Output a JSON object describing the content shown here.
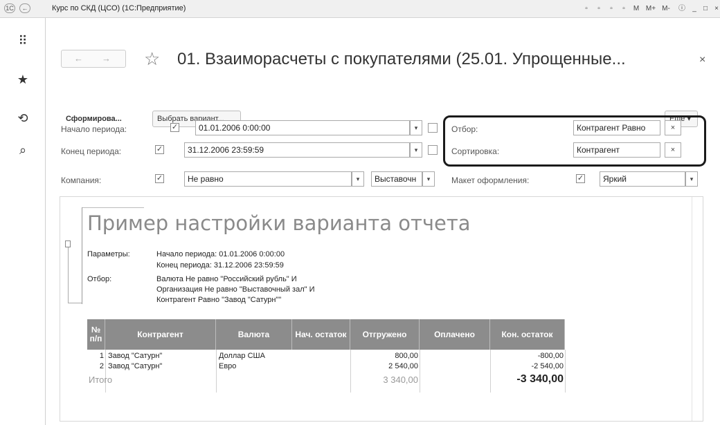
{
  "window": {
    "title": "Курс по СКД (ЦСО) (1С:Предприятие)",
    "toolbar_m_labels": [
      "M",
      "M+",
      "M-"
    ]
  },
  "header": {
    "title": "01. Взаиморасчеты с покупателями (25.01. Упрощенные...",
    "back_arrow": "←",
    "forward_arrow": "→",
    "close": "×"
  },
  "toolbar": {
    "generate_label": "Сформирова...",
    "variant_label": "Выбрать вариант...",
    "more_label": "Еще ▾"
  },
  "form": {
    "period_start_label": "Начало периода:",
    "period_start_value": "01.01.2006 0:00:00",
    "period_end_label": "Конец периода:",
    "period_end_value": "31.12.2006 23:59:59",
    "company_label": "Компания:",
    "company_condition": "Не равно",
    "company_value": "Выставочн",
    "filter_label": "Отбор:",
    "filter_value": "Контрагент Равно",
    "sort_label": "Сортировка:",
    "sort_value": "Контрагент",
    "layout_label": "Макет оформления:",
    "layout_value": "Яркий"
  },
  "report": {
    "title": "Пример настройки варианта отчета",
    "params_label": "Параметры:",
    "param_start": "Начало периода: 01.01.2006 0:00:00",
    "param_end": "Конец периода: 31.12.2006 23:59:59",
    "filter_label": "Отбор:",
    "filter_line1": "Валюта Не равно \"Российский рубль\" И",
    "filter_line2": "Организация Не равно \"Выставочный зал\" И",
    "filter_line3": "Контрагент Равно \"Завод \"Сатурн\"\"",
    "columns": [
      "№ п/п",
      "Контрагент",
      "Валюта",
      "Нач. остаток",
      "Отгружено",
      "Оплачено",
      "Кон. остаток"
    ],
    "rows": [
      {
        "num": "1",
        "counterparty": "Завод \"Сатурн\"",
        "currency": "Доллар США",
        "start": "",
        "shipped": "800,00",
        "paid": "",
        "end": "-800,00"
      },
      {
        "num": "2",
        "counterparty": "Завод \"Сатурн\"",
        "currency": "Евро",
        "start": "",
        "shipped": "2 540,00",
        "paid": "",
        "end": "-2 540,00"
      }
    ],
    "total_label": "Итого",
    "total_shipped": "3 340,00",
    "total_end": "-3 340,00"
  },
  "colors": {
    "table_header": "#8c8c8c",
    "highlight_border": "#1a1a1a"
  }
}
